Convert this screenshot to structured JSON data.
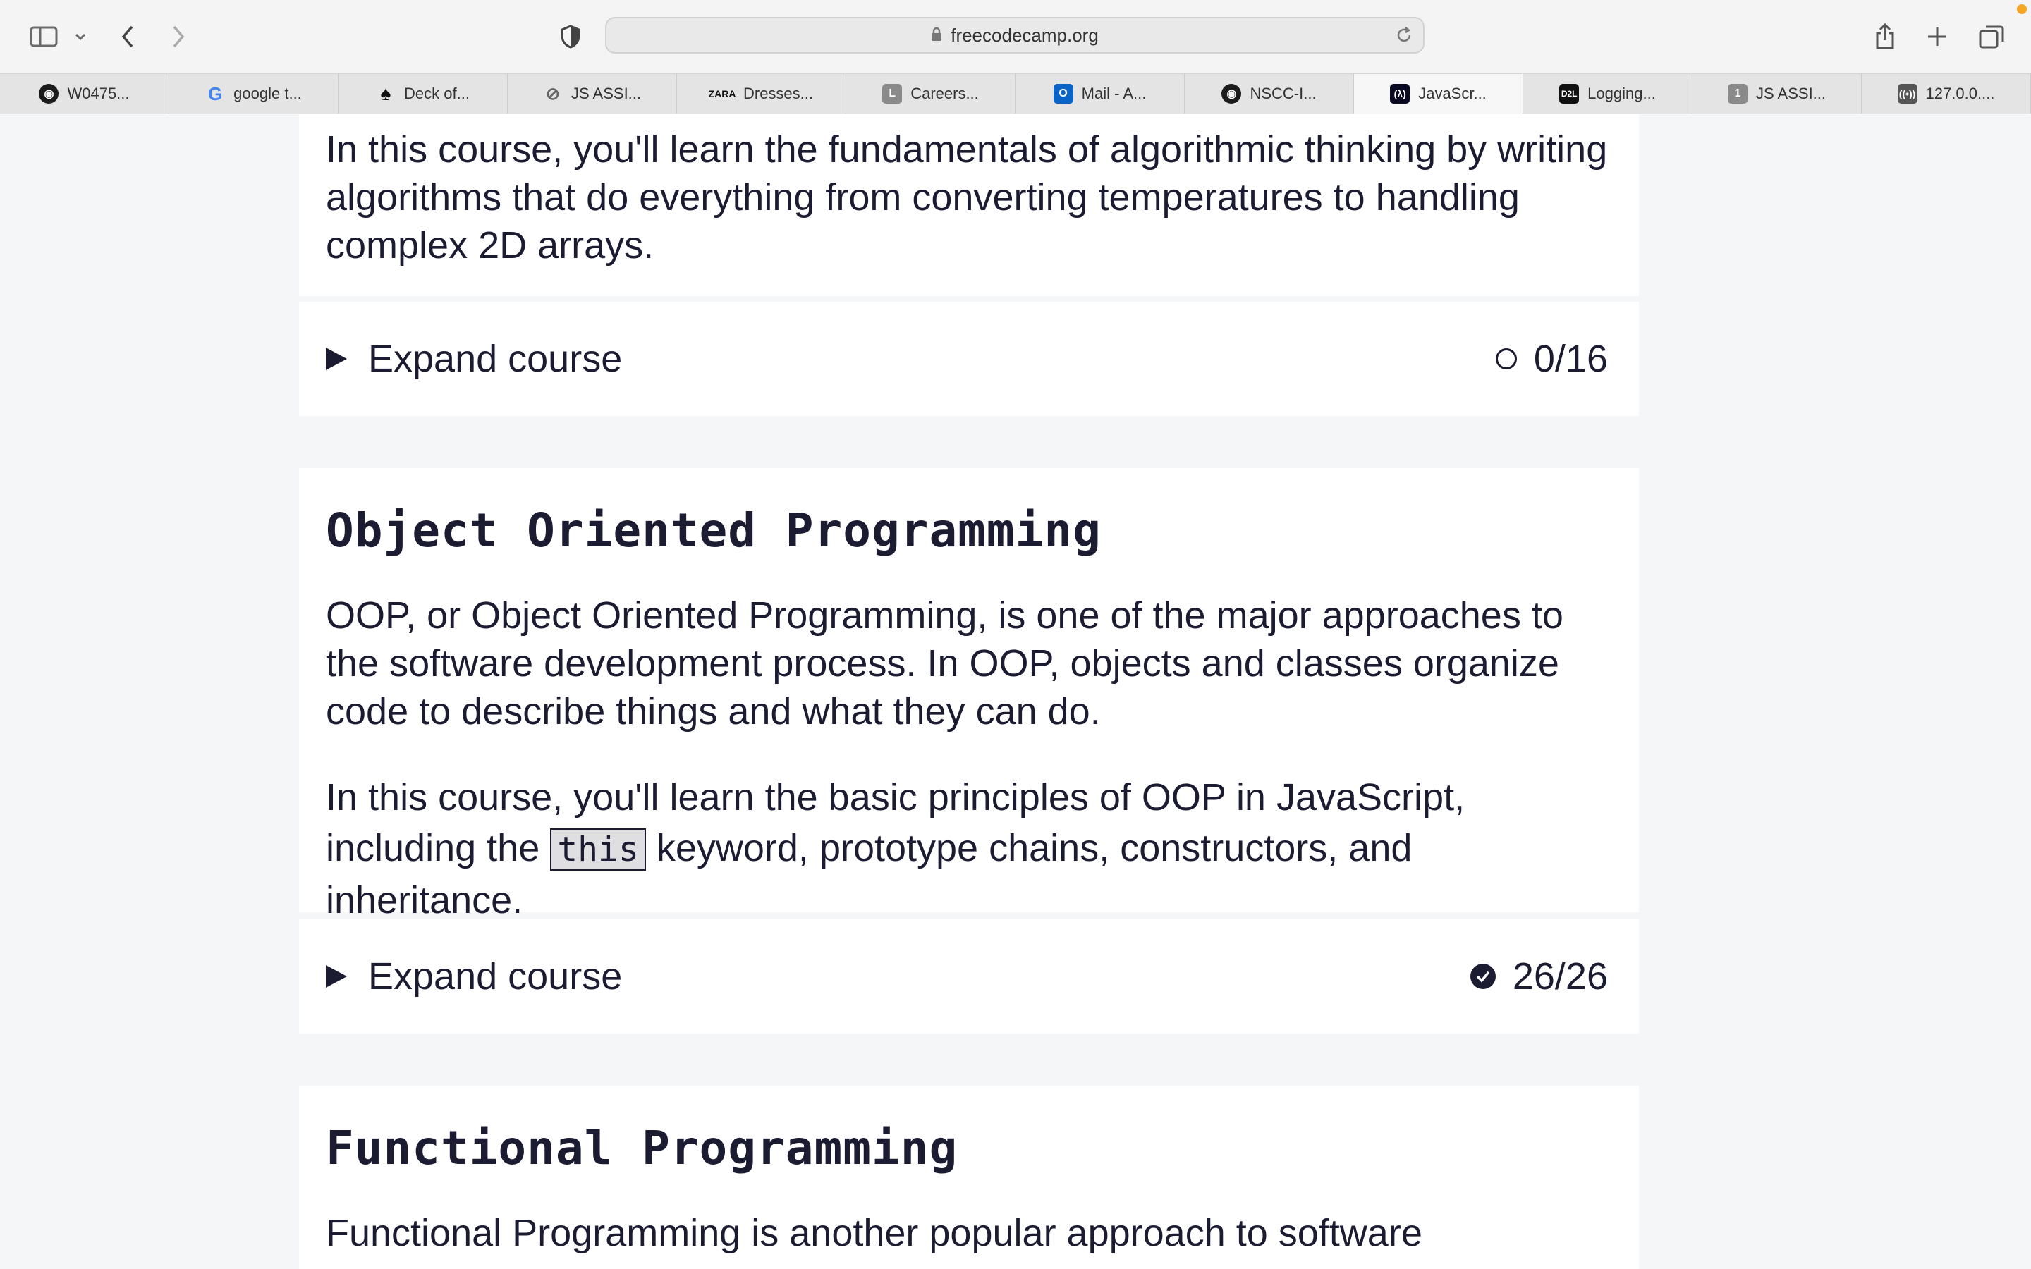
{
  "browser": {
    "url": "freecodecamp.org",
    "tabs": [
      {
        "label": "W0475...",
        "icon": "github-icon"
      },
      {
        "label": "google t...",
        "icon": "google-icon"
      },
      {
        "label": "Deck of...",
        "icon": "spade-icon"
      },
      {
        "label": "JS ASSI...",
        "icon": "compass-icon"
      },
      {
        "label": "Dresses...",
        "icon": "zara-icon"
      },
      {
        "label": "Careers...",
        "icon": "l-icon"
      },
      {
        "label": "Mail - A...",
        "icon": "outlook-icon"
      },
      {
        "label": "NSCC-I...",
        "icon": "github-icon"
      },
      {
        "label": "JavaScr...",
        "icon": "freecodecamp-icon",
        "active": true
      },
      {
        "label": "Logging...",
        "icon": "d2l-icon"
      },
      {
        "label": "JS ASSI...",
        "icon": "one-icon"
      },
      {
        "label": "127.0.0....",
        "icon": "broadcast-icon"
      }
    ]
  },
  "section1": {
    "description": "In this course, you'll learn the fundamentals of algorithmic thinking by writing algorithms that do everything from converting temperatures to handling complex 2D arrays.",
    "expand_label": "Expand course",
    "progress": "0/16",
    "completed": false
  },
  "section2": {
    "title": "Object Oriented Programming",
    "para1": "OOP, or Object Oriented Programming, is one of the major approaches to the software development process. In OOP, objects and classes organize code to describe things and what they can do.",
    "para2_before": "In this course, you'll learn the basic principles of OOP in JavaScript, including the",
    "para2_code": "this",
    "para2_after": "keyword, prototype chains, constructors, and inheritance.",
    "expand_label": "Expand course",
    "progress": "26/26",
    "completed": true
  },
  "section3": {
    "title": "Functional Programming",
    "para1": "Functional Programming is another popular approach to software"
  }
}
